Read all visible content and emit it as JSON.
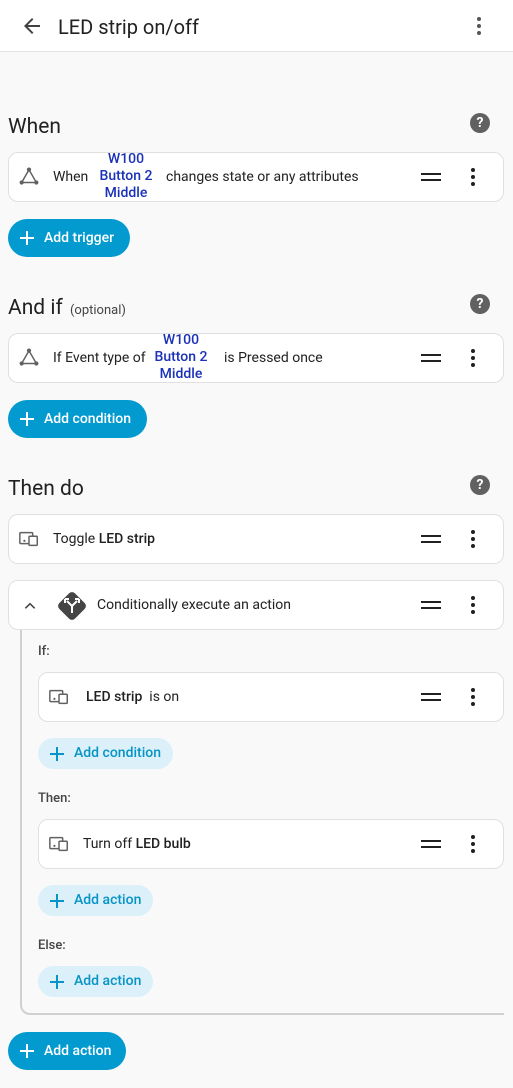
{
  "header": {
    "title": "LED strip on/off",
    "back_icon": "arrow-left-icon",
    "menu_icon": "kebab-menu-icon"
  },
  "when": {
    "title": "When",
    "trigger": {
      "prefix": "When",
      "entity_lines": [
        "W100",
        "Button 2",
        "Middle"
      ],
      "suffix": "changes state or any attributes"
    },
    "add_button": "Add trigger"
  },
  "and_if": {
    "title": "And if",
    "optional": "(optional)",
    "condition": {
      "prefix": "If Event type of",
      "entity_lines": [
        "W100",
        "Button 2",
        "Middle"
      ],
      "suffix": "is Pressed once"
    },
    "add_button": "Add condition"
  },
  "then_do": {
    "title": "Then do",
    "toggle": {
      "verb": "Toggle",
      "entity": "LED strip"
    },
    "choose": {
      "title": "Conditionally execute an action",
      "if_label": "If:",
      "if_card": {
        "entity": "LED strip",
        "state": "is on"
      },
      "if_add": "Add condition",
      "then_label": "Then:",
      "then_card": {
        "verb": "Turn off",
        "entity": "LED bulb"
      },
      "then_add": "Add action",
      "else_label": "Else:",
      "else_add": "Add action"
    },
    "add_button": "Add action"
  },
  "colors": {
    "accent": "#039bcf",
    "tonal_bg": "#dbf0f9",
    "entity_link": "#1a31b8"
  }
}
